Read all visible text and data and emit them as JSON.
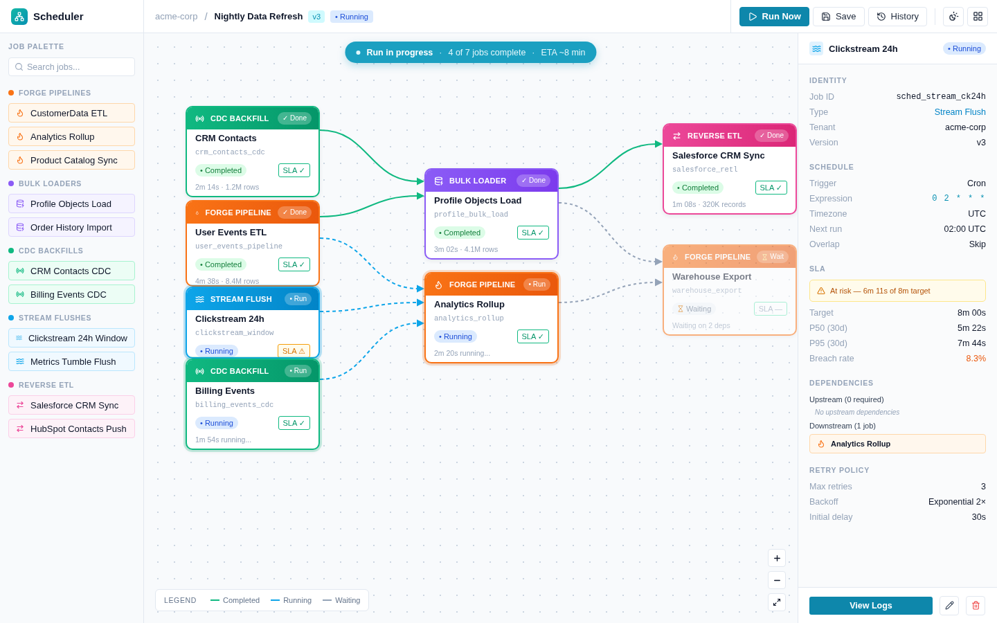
{
  "app": {
    "name": "Scheduler"
  },
  "breadcrumb": {
    "tenant": "acme-corp",
    "separator": "/",
    "pipeline": "Nightly Data Refresh",
    "version": "v3",
    "status": {
      "kind": "running",
      "label": "• Running"
    }
  },
  "toolbar": {
    "buttons": [
      {
        "kind": "run",
        "label": "Run Now"
      },
      {
        "kind": "save",
        "label": "Save"
      },
      {
        "kind": "history",
        "label": "History"
      }
    ]
  },
  "palette": {
    "title": "JOB PALETTE",
    "search": {
      "placeholder": "Search jobs..."
    },
    "groups": [
      {
        "kind": "forge",
        "title": "FORGE PIPELINES",
        "items": [
          "CustomerData ETL",
          "Analytics Rollup",
          "Product Catalog Sync"
        ]
      },
      {
        "kind": "bulk",
        "title": "BULK LOADERS",
        "items": [
          "Profile Objects Load",
          "Order History Import"
        ]
      },
      {
        "kind": "cdc",
        "title": "CDC BACKFILLS",
        "items": [
          "CRM Contacts CDC",
          "Billing Events CDC"
        ]
      },
      {
        "kind": "stream",
        "title": "STREAM FLUSHES",
        "items": [
          "Clickstream 24h Window",
          "Metrics Tumble Flush"
        ]
      },
      {
        "kind": "reverse",
        "title": "REVERSE ETL",
        "items": [
          "Salesforce CRM Sync",
          "HubSpot Contacts Push"
        ]
      }
    ]
  },
  "banner": {
    "title": "Run in progress",
    "separator": "·",
    "details": [
      "4 of 7 jobs complete",
      "ETA ~8 min"
    ]
  },
  "nodes": [
    {
      "kind": "cdc",
      "type_label": "CDC BACKFILL",
      "badge": {
        "kind": "done",
        "label": "✓ Done"
      },
      "title": "CRM Contacts",
      "slug": "crm_contacts_cdc",
      "status": {
        "kind": "completed",
        "label": "• Completed"
      },
      "sla": {
        "kind": "ok",
        "label": "SLA ✓"
      },
      "footer": "2m 14s · 1.2M rows"
    },
    {
      "kind": "forge",
      "type_label": "FORGE PIPELINE",
      "badge": {
        "kind": "done",
        "label": "✓ Done"
      },
      "title": "User Events ETL",
      "slug": "user_events_pipeline",
      "status": {
        "kind": "completed",
        "label": "• Completed"
      },
      "sla": {
        "kind": "ok",
        "label": "SLA ✓"
      },
      "footer": "4m 38s · 8.4M rows"
    },
    {
      "kind": "stream",
      "type_label": "STREAM FLUSH",
      "badge": {
        "kind": "run",
        "label": "• Run"
      },
      "title": "Clickstream 24h",
      "slug": "clickstream_window",
      "status": {
        "kind": "running",
        "label": "• Running"
      },
      "sla": {
        "kind": "risk",
        "label": "SLA ⚠"
      }
    },
    {
      "kind": "cdc",
      "type_label": "CDC BACKFILL",
      "badge": {
        "kind": "run",
        "label": "• Run"
      },
      "title": "Billing Events",
      "slug": "billing_events_cdc",
      "status": {
        "kind": "running",
        "label": "• Running"
      },
      "sla": {
        "kind": "ok",
        "label": "SLA ✓"
      },
      "footer": "1m 54s running..."
    },
    {
      "kind": "bulk",
      "type_label": "BULK LOADER",
      "badge": {
        "kind": "done",
        "label": "✓ Done"
      },
      "title": "Profile Objects Load",
      "slug": "profile_bulk_load",
      "status": {
        "kind": "completed",
        "label": "• Completed"
      },
      "sla": {
        "kind": "ok",
        "label": "SLA ✓"
      },
      "footer": "3m 02s · 4.1M rows"
    },
    {
      "kind": "forge",
      "type_label": "FORGE PIPELINE",
      "badge": {
        "kind": "run",
        "label": "• Run"
      },
      "title": "Analytics Rollup",
      "slug": "analytics_rollup",
      "status": {
        "kind": "running",
        "label": "• Running"
      },
      "sla": {
        "kind": "ok",
        "label": "SLA ✓"
      },
      "footer": "2m 20s running..."
    },
    {
      "kind": "reverse",
      "type_label": "REVERSE ETL",
      "badge": {
        "kind": "done",
        "label": "✓ Done"
      },
      "title": "Salesforce CRM Sync",
      "slug": "salesforce_retl",
      "status": {
        "kind": "completed",
        "label": "• Completed"
      },
      "sla": {
        "kind": "ok",
        "label": "SLA ✓"
      },
      "footer": "1m 08s · 320K records"
    },
    {
      "kind": "forge",
      "type_label": "FORGE PIPELINE",
      "badge": {
        "kind": "wait",
        "label": "Wait"
      },
      "title": "Warehouse Export",
      "slug": "warehouse_export",
      "status": {
        "kind": "waiting",
        "label": "Waiting"
      },
      "sla": {
        "kind": "none",
        "label": "SLA —"
      },
      "footer": "Waiting on 2 deps"
    }
  ],
  "edges": [
    {
      "kind": "completed"
    },
    {
      "kind": "completed"
    },
    {
      "kind": "running"
    },
    {
      "kind": "running"
    },
    {
      "kind": "running"
    },
    {
      "kind": "completed"
    },
    {
      "kind": "waiting"
    },
    {
      "kind": "waiting"
    }
  ],
  "legend": {
    "title": "LEGEND",
    "items": [
      {
        "kind": "completed",
        "label": "Completed"
      },
      {
        "kind": "running",
        "label": "Running"
      },
      {
        "kind": "waiting",
        "label": "Waiting"
      }
    ]
  },
  "inspector": {
    "kind": "stream",
    "title": "Clickstream 24h",
    "status": {
      "kind": "running",
      "label": "• Running"
    },
    "identity": {
      "title": "IDENTITY",
      "rows": [
        {
          "kind": "mono",
          "label": "Job ID",
          "value": "sched_stream_ck24h"
        },
        {
          "kind": "link",
          "label": "Type",
          "value": "Stream Flush"
        },
        {
          "kind": "plain",
          "label": "Tenant",
          "value": "acme-corp"
        },
        {
          "kind": "plain",
          "label": "Version",
          "value": "v3"
        }
      ]
    },
    "schedule": {
      "title": "SCHEDULE",
      "rows": [
        {
          "kind": "plain",
          "label": "Trigger",
          "value": "Cron"
        },
        {
          "kind": "code",
          "label": "Expression",
          "value": "0 2 * * *"
        },
        {
          "kind": "plain",
          "label": "Timezone",
          "value": "UTC"
        },
        {
          "kind": "plain",
          "label": "Next run",
          "value": "02:00 UTC"
        },
        {
          "kind": "plain",
          "label": "Overlap",
          "value": "Skip"
        }
      ]
    },
    "sla": {
      "title": "SLA",
      "alert": "At risk — 6m 11s of 8m target",
      "rows": [
        {
          "kind": "plain",
          "label": "Target",
          "value": "8m 00s"
        },
        {
          "kind": "plain",
          "label": "P50 (30d)",
          "value": "5m 22s"
        },
        {
          "kind": "plain",
          "label": "P95 (30d)",
          "value": "7m 44s"
        },
        {
          "kind": "warn",
          "label": "Breach rate",
          "value": "8.3%"
        }
      ]
    },
    "dependencies": {
      "title": "DEPENDENCIES",
      "upstream_label": "Upstream (0 required)",
      "upstream_empty": "No upstream dependencies",
      "downstream_label": "Downstream (1 job)",
      "downstream": [
        {
          "kind": "forge",
          "name": "Analytics Rollup"
        }
      ]
    },
    "retry_policy": {
      "title": "RETRY POLICY",
      "rows": [
        {
          "kind": "plain",
          "label": "Max retries",
          "value": "3"
        },
        {
          "kind": "plain",
          "label": "Backoff",
          "value": "Exponential 2×"
        },
        {
          "kind": "plain",
          "label": "Initial delay",
          "value": "30s"
        }
      ]
    },
    "primary_action": "View Logs"
  }
}
